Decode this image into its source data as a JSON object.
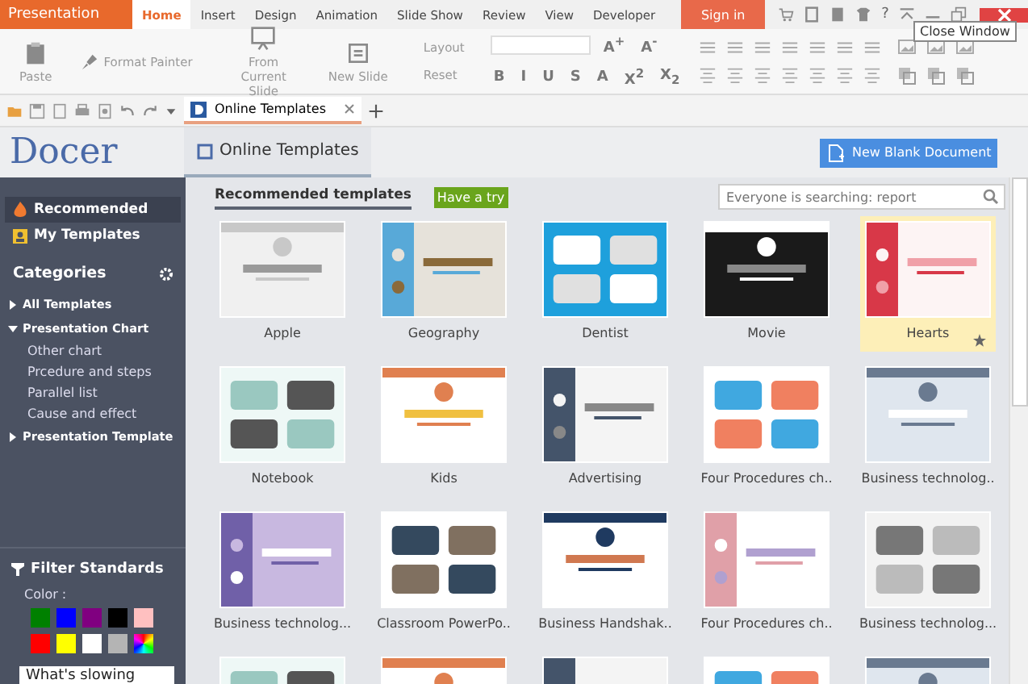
{
  "app_menu": {
    "label": "Presentation"
  },
  "ribbon_tabs": [
    {
      "label": "Home",
      "selected": true
    },
    {
      "label": "Insert",
      "selected": false
    },
    {
      "label": "Design",
      "selected": false
    },
    {
      "label": "Animation",
      "selected": false
    },
    {
      "label": "Slide Show",
      "selected": false
    },
    {
      "label": "Review",
      "selected": false
    },
    {
      "label": "View",
      "selected": false
    },
    {
      "label": "Developer",
      "selected": false
    }
  ],
  "sign_in": "Sign in",
  "help": "?",
  "tooltip": "Close Window",
  "ribbon": {
    "clipboard": [
      {
        "label": "Paste",
        "kind": "paste"
      },
      {
        "label": "Format Painter",
        "kind": "painter"
      }
    ],
    "slides": [
      {
        "label": "From Current Slide",
        "kind": "projector"
      },
      {
        "label": "New Slide",
        "kind": "slide"
      }
    ],
    "layout": [
      {
        "label": "Layout"
      },
      {
        "label": "Reset"
      }
    ],
    "format": [
      "B",
      "I",
      "U",
      "S",
      "A",
      "X$^{2}$",
      "X$_{2}$"
    ],
    "font_size": [
      "A$^{+}$",
      "A$^{-}$"
    ]
  },
  "document_tab": {
    "label": "Online Templates"
  },
  "docer": {
    "logo": "Docer",
    "tab": "Online Templates",
    "new_button": "New Blank Document"
  },
  "sidebar": {
    "nav": [
      {
        "label": "Recommended",
        "selected": true,
        "kind": "flame"
      },
      {
        "label": "My Templates",
        "selected": false,
        "kind": "portrait"
      }
    ],
    "categories_title": "Categories",
    "tree": [
      {
        "label": "All Templates",
        "expanded": false
      },
      {
        "label": "Presentation Chart",
        "expanded": true,
        "children": [
          {
            "label": "Other chart"
          },
          {
            "label": "Prcedure and steps"
          },
          {
            "label": "Parallel list"
          },
          {
            "label": "Cause and effect"
          }
        ]
      },
      {
        "label": "Presentation Template",
        "expanded": false
      }
    ],
    "filter_title": "Filter Standards",
    "color_label": "Color :",
    "colors": [
      {
        "kind": "solid",
        "color": "#008000"
      },
      {
        "kind": "solid",
        "color": "#0000ff"
      },
      {
        "kind": "solid",
        "color": "#800080"
      },
      {
        "kind": "solid",
        "color": "#000000"
      },
      {
        "kind": "solid",
        "color": "#ffc0c0"
      },
      {
        "kind": "solid",
        "color": "#ff0000"
      },
      {
        "kind": "solid",
        "color": "#ffff00"
      },
      {
        "kind": "solid",
        "color": "#ffffff"
      },
      {
        "kind": "solid",
        "color": "#b4b4b4"
      },
      {
        "kind": "multicolor"
      }
    ],
    "feedback": "What's slowing"
  },
  "content": {
    "tabs": [
      {
        "label": "Recommended templates",
        "selected": true
      }
    ],
    "badge": "Have a try",
    "search": {
      "placeholder": "Everyone is searching: report"
    },
    "templates": [
      {
        "name": "Apple",
        "selected": false
      },
      {
        "name": "Geography",
        "selected": false
      },
      {
        "name": "Dentist",
        "selected": false
      },
      {
        "name": "Movie",
        "selected": false
      },
      {
        "name": "Hearts",
        "selected": true
      },
      {
        "name": "Notebook",
        "selected": false
      },
      {
        "name": "Kids",
        "selected": false
      },
      {
        "name": "Advertising",
        "selected": false
      },
      {
        "name": "Four Procedures ch..",
        "selected": false
      },
      {
        "name": "Business technolog..",
        "selected": false
      },
      {
        "name": "Business technolog...",
        "selected": false
      },
      {
        "name": "Classroom PowerPo..",
        "selected": false
      },
      {
        "name": "Business Handshak..",
        "selected": false
      },
      {
        "name": "Four Procedures ch..",
        "selected": false
      },
      {
        "name": "Business technolog...",
        "selected": false
      }
    ]
  }
}
